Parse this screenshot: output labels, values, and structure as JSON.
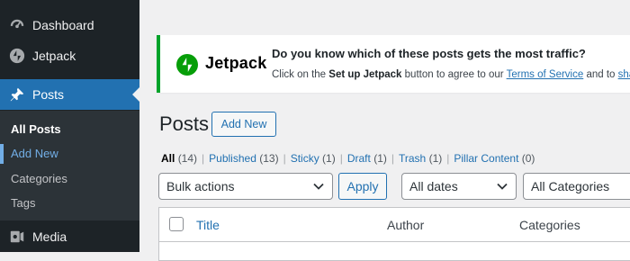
{
  "sidebar": {
    "items": [
      {
        "label": "Dashboard",
        "icon": "dashboard-icon"
      },
      {
        "label": "Jetpack",
        "icon": "jetpack-icon"
      },
      {
        "label": "Posts",
        "icon": "pin-icon",
        "current": true
      },
      {
        "label": "Media",
        "icon": "media-icon"
      }
    ],
    "submenu": [
      {
        "label": "All Posts",
        "active": true
      },
      {
        "label": "Add New"
      },
      {
        "label": "Categories"
      },
      {
        "label": "Tags"
      }
    ]
  },
  "notice": {
    "brand": "Jetpack",
    "title": "Do you know which of these posts gets the most traffic?",
    "text_1": "Click on the ",
    "text_bold": "Set up Jetpack",
    "text_2": " button to agree to our ",
    "tos_link": "Terms of Service",
    "text_3": " and to ",
    "share_link": "sha",
    "accent": "#00a32a"
  },
  "header": {
    "title": "Posts",
    "add_new": "Add New"
  },
  "views": [
    {
      "label": "All",
      "count": "(14)",
      "current": true
    },
    {
      "label": "Published",
      "count": "(13)"
    },
    {
      "label": "Sticky",
      "count": "(1)"
    },
    {
      "label": "Draft",
      "count": "(1)"
    },
    {
      "label": "Trash",
      "count": "(1)"
    },
    {
      "label": "Pillar Content",
      "count": "(0)"
    }
  ],
  "filters": {
    "bulk_actions": "Bulk actions",
    "apply": "Apply",
    "dates": "All dates",
    "categories": "All Categories"
  },
  "table": {
    "columns": [
      "Title",
      "Author",
      "Categories"
    ]
  },
  "colors": {
    "sidebar": "#1d2327",
    "accent": "#2271b1",
    "submenu": "#2c3338"
  }
}
